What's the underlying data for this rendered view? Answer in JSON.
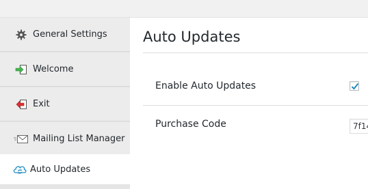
{
  "sidebar": {
    "items": [
      {
        "label": "General Settings",
        "icon": "gear-icon"
      },
      {
        "label": "Welcome",
        "icon": "sign-in-arrow-icon"
      },
      {
        "label": "Exit",
        "icon": "sign-out-arrow-icon"
      },
      {
        "label": "Mailing List Manager",
        "icon": "envelope-icon"
      },
      {
        "label": "Auto Updates",
        "icon": "cloud-sync-icon",
        "active": true
      }
    ]
  },
  "main": {
    "title": "Auto Updates",
    "enable_auto_updates": {
      "label": "Enable Auto Updates",
      "checked": true
    },
    "purchase_code": {
      "label": "Purchase Code",
      "value": "7f14"
    }
  },
  "colors": {
    "accent_blue": "#1e8cbe",
    "arrow_green": "#46b450",
    "arrow_red": "#dc3232"
  }
}
